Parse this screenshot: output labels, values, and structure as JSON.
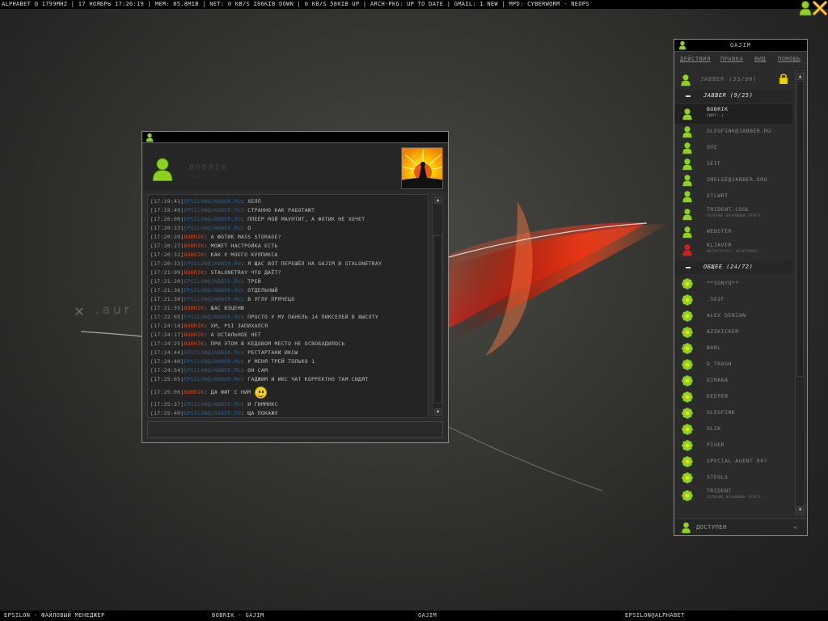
{
  "topbar": {
    "status_text": "ALPHABET @ 1799MHZ | 17 НОЯБРЬ 17:26:19 | MEM: 85.8MIB | NET: 0 KB/S 286KIB DOWN | 0 KB/S 58KIB UP | ARCH-PKG: UP TO DATE | GMAIL: 1 NEW | MPD: CYBERWORM - NEOPS"
  },
  "desktop": {
    "wallpaper_text": ".aur"
  },
  "taskbar": {
    "tasks": [
      "EPSILON - ФАЙЛОВЫЙ МЕНЕДЖЕР",
      "BOBRIK - GAJIM",
      "GAJIM",
      "EPSILON@ALPHABET"
    ]
  },
  "chat": {
    "contact_name": "BOBRIK",
    "contact_status": "СЫЧ?:-)",
    "messages": [
      {
        "ts": "[17:19:41]",
        "nick": "EPSILON@JABBER.RU",
        "who": "me",
        "text": "ХЕЛП"
      },
      {
        "ts": "[17:19:49]",
        "nick": "EPSILON@JABBER.RU",
        "who": "me",
        "text": "СТРАННО КАК РАБОТАЮТ"
      },
      {
        "ts": "[17:20:00]",
        "nick": "EPSILON@JABBER.RU",
        "who": "me",
        "text": "ПЛЕЕР МОЙ МАУНТИТ, А ФОТИК НЕ ХОЧЕТ"
      },
      {
        "ts": "[17:20:13]",
        "nick": "EPSILON@JABBER.RU",
        "who": "me",
        "text": "О"
      },
      {
        "ts": "[17:20:20]",
        "nick": "BOBRIK",
        "who": "peer",
        "text": "А ФОТИК MASS STORAGE?"
      },
      {
        "ts": "[17:20:27]",
        "nick": "BOBRIK",
        "who": "peer",
        "text": "МОЖЕТ НАСТРОЙКА ЕСТЬ"
      },
      {
        "ts": "[17:20:32]",
        "nick": "BOBRIK",
        "who": "peer",
        "text": "КАК У МОЕГО КУЛПИКСА"
      },
      {
        "ts": "[17:20:33]",
        "nick": "EPSILON@JABBER.RU",
        "who": "me",
        "text": "Я ЩАС ВОТ ПЕРЕШЁЛ НА GAJIM И STALONETRAY"
      },
      {
        "ts": "[17:21:09]",
        "nick": "BOBRIK",
        "who": "peer",
        "text": "STALONETRAY ЧТО ДАЁТ?"
      },
      {
        "ts": "[17:21:20]",
        "nick": "EPSILON@JABBER.RU",
        "who": "me",
        "text": "ТРЕЙ"
      },
      {
        "ts": "[17:21:36]",
        "nick": "EPSILON@JABBER.RU",
        "who": "me",
        "text": "ОТДЕЛЬНЫЙ"
      },
      {
        "ts": "[17:21:50]",
        "nick": "EPSILON@JABBER.RU",
        "who": "me",
        "text": "В УГЛУ ПРЯЧЕЦО"
      },
      {
        "ts": "[17:21:55]",
        "nick": "BOBRIK",
        "who": "peer",
        "text": "ЩАС ВЗЦЕНЮ"
      },
      {
        "ts": "[17:22:05]",
        "nick": "EPSILON@JABBER.RU",
        "who": "me",
        "text": "ПРОСТО У МУ ПАНЕЛЬ 14 ПИКСЕЛЕЙ В ВЫСОТУ"
      },
      {
        "ts": "[17:24:14]",
        "nick": "BOBRIK",
        "who": "peer",
        "text": "ХМ, PSI ЗАПИХАЛСЯ"
      },
      {
        "ts": "[17:24:17]",
        "nick": "BOBRIK",
        "who": "peer",
        "text": "А ОСТАЛЬНОЕ НЕТ"
      },
      {
        "ts": "[17:24:25]",
        "nick": "BOBRIK",
        "who": "peer",
        "text": "ПРИ ЭТОМ В КЕДОВОМ МЕСТО НЕ ОСВОБОДИЛОСЬ"
      },
      {
        "ts": "[17:24:44]",
        "nick": "EPSILON@JABBER.RU",
        "who": "me",
        "text": "РЕСТАРТАНИ ИКСЫ"
      },
      {
        "ts": "[17:24:48]",
        "nick": "EPSILON@JABBER.RU",
        "who": "me",
        "text": "У МЕНЯ ТРЕЙ ТОЛЬКО 1"
      },
      {
        "ts": "[17:24:54]",
        "nick": "EPSILON@JABBER.RU",
        "who": "me",
        "text": "ОН САМ"
      },
      {
        "ts": "[17:25:05]",
        "nick": "EPSILON@JABBER.RU",
        "who": "me",
        "text": "ГАДЖИМ И ИКС ЧАТ КОРРЕКТНО ТАМ СИДЯТ"
      },
      {
        "ts": "[17:25:06]",
        "nick": "BOBRIK",
        "who": "peer",
        "text": "ДА ФИГ С НИМ",
        "smiley": true
      },
      {
        "ts": "[17:25:37]",
        "nick": "EPSILON@JABBER.RU",
        "who": "me",
        "text": "И ГИММИКС"
      },
      {
        "ts": "[17:25:40]",
        "nick": "EPSILON@JABBER.RU",
        "who": "me",
        "text": "ЩА ПОКАЖУ"
      }
    ]
  },
  "roster": {
    "title": "GAJIM",
    "menu": [
      "ДЕЙСТВИЯ",
      "ПРАВКА",
      "ВИД",
      "ПОМОЩЬ"
    ],
    "account_label": "JABBER (33/98)",
    "groups": [
      {
        "label": "JABBER (9/25)",
        "contacts": [
          {
            "name": "BOBRIK",
            "sub": "СЫЧ?:-)",
            "color": "green",
            "selected": true
          },
          {
            "name": "OLEGFINK@JABBER.RU",
            "sub": "",
            "color": "green"
          },
          {
            "name": "OVE",
            "sub": "",
            "color": "green"
          },
          {
            "name": "SEIF",
            "sub": "",
            "color": "green"
          },
          {
            "name": "SMELSE@JABBER.ORG",
            "sub": "",
            "color": "green"
          },
          {
            "name": "STLWRT",
            "sub": "",
            "color": "green"
          },
          {
            "name": "TRIDENT.COOL",
            "sub": "ЗЕЛЁНЫЕ ШТАНИШКИ ОТОГО...",
            "color": "green"
          },
          {
            "name": "WEBSTER",
            "sub": "",
            "color": "green"
          },
          {
            "name": "KLJAVER",
            "sub": "АВТОСТАТУС: НЕАКТИВЕН",
            "color": "red"
          }
        ]
      },
      {
        "label": "ОБЩЕЕ (24/72)",
        "contacts": [
          {
            "name": "**SONYQ**",
            "sub": "",
            "color": "flower"
          },
          {
            "name": ".SEIF",
            "sub": "",
            "color": "flower"
          },
          {
            "name": "ALEX DEBIAN",
            "sub": "",
            "color": "flower"
          },
          {
            "name": "AZZKICKER",
            "sub": "",
            "color": "flower"
          },
          {
            "name": "BABL",
            "sub": "",
            "color": "flower"
          },
          {
            "name": "D_TRASH",
            "sub": "",
            "color": "flower"
          },
          {
            "name": "DIMAKA",
            "sub": "",
            "color": "flower"
          },
          {
            "name": "KEEPER",
            "sub": "",
            "color": "flower"
          },
          {
            "name": "OLEGFINK",
            "sub": "",
            "color": "flower"
          },
          {
            "name": "OLIK",
            "sub": "",
            "color": "flower"
          },
          {
            "name": "PIVER",
            "sub": "",
            "color": "flower"
          },
          {
            "name": "SPECIAL AGENT 007",
            "sub": "",
            "color": "flower"
          },
          {
            "name": "STEGLS",
            "sub": "",
            "color": "flower"
          },
          {
            "name": "TRIDENT",
            "sub": "ЗЕЛЁНЫЕ ШТАНИШКИ ОТОГО...",
            "color": "flower"
          }
        ]
      }
    ],
    "status": "ДОСТУПЕН"
  },
  "colors": {
    "nick_me": "#2f5f8a",
    "nick_peer": "#c84a28",
    "online_green": "#8cd21e",
    "busy_red": "#d21e1e"
  },
  "icons": {
    "tray": [
      "gajim-tray-icon",
      "close-tray-icon"
    ],
    "contact_online": "person-icon",
    "contact_icq": "flower-icon",
    "account_lock": "lock-icon"
  }
}
